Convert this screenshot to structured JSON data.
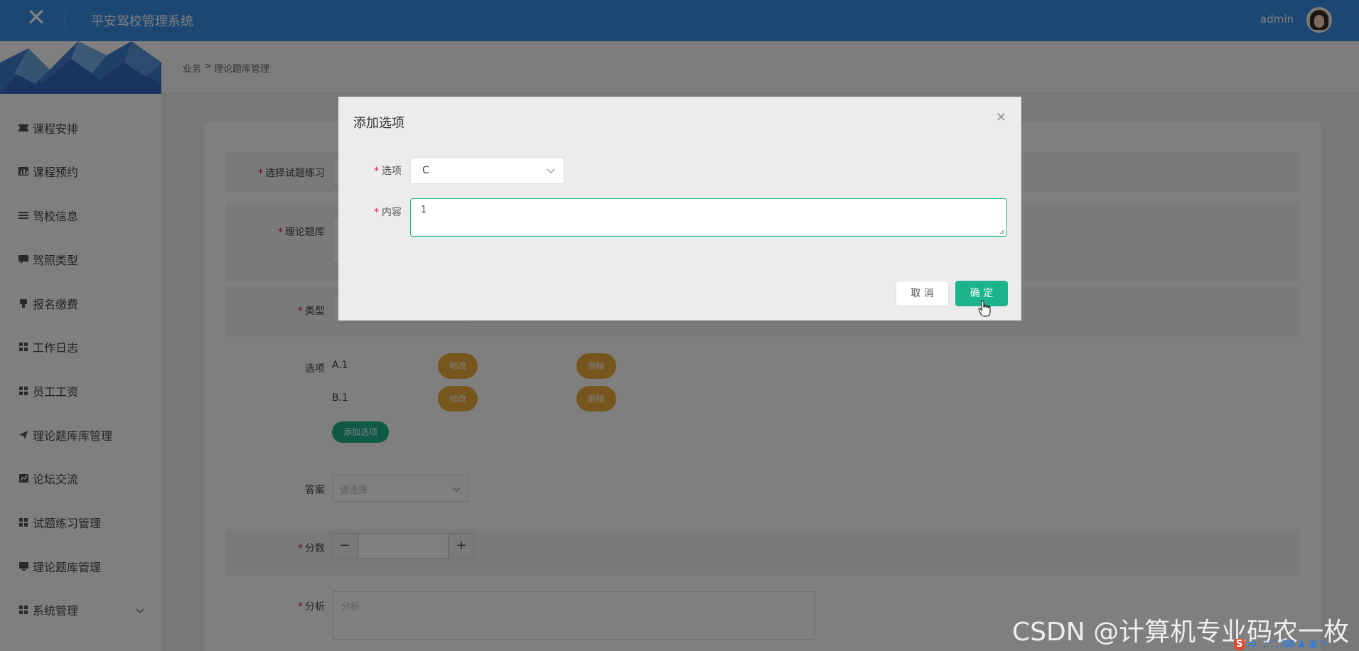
{
  "header": {
    "title": "平安驾校管理系统",
    "user": "admin"
  },
  "breadcrumb": {
    "parent": "业务",
    "separator": ">",
    "current": "理论题库管理"
  },
  "sidebar": {
    "items": [
      {
        "label": "课程安排"
      },
      {
        "label": "课程预约"
      },
      {
        "label": "驾校信息"
      },
      {
        "label": "驾照类型"
      },
      {
        "label": "报名缴费"
      },
      {
        "label": "工作日志"
      },
      {
        "label": "员工工资"
      },
      {
        "label": "理论题库库管理"
      },
      {
        "label": "论坛交流"
      },
      {
        "label": "试题练习管理"
      },
      {
        "label": "理论题库管理"
      },
      {
        "label": "系统管理"
      }
    ]
  },
  "form": {
    "exercise_label": "选择试题练习",
    "bank_label": "理论题库",
    "type_label": "类型",
    "options_label": "选项",
    "options": [
      {
        "text": "A.1",
        "edit": "修改",
        "delete": "删除"
      },
      {
        "text": "B.1",
        "edit": "修改",
        "delete": "删除"
      }
    ],
    "add_option": "添加选项",
    "answer_label": "答案",
    "answer_placeholder": "请选择",
    "score_label": "分数",
    "score_minus": "−",
    "score_plus": "+",
    "analysis_label": "分析",
    "analysis_placeholder": "分析"
  },
  "dialog": {
    "title": "添加选项",
    "option_label": "选项",
    "option_value": "C",
    "content_label": "内容",
    "content_value": "1",
    "cancel": "取 消",
    "confirm": "确 定"
  },
  "watermark": "CSDN @计算机专业码农一枚",
  "tray": {
    "ime": "中"
  },
  "colors": {
    "header": "#3a8ee6",
    "accent_green": "#1db48b",
    "accent_yellow": "#efad3a",
    "required": "#ee1144"
  }
}
